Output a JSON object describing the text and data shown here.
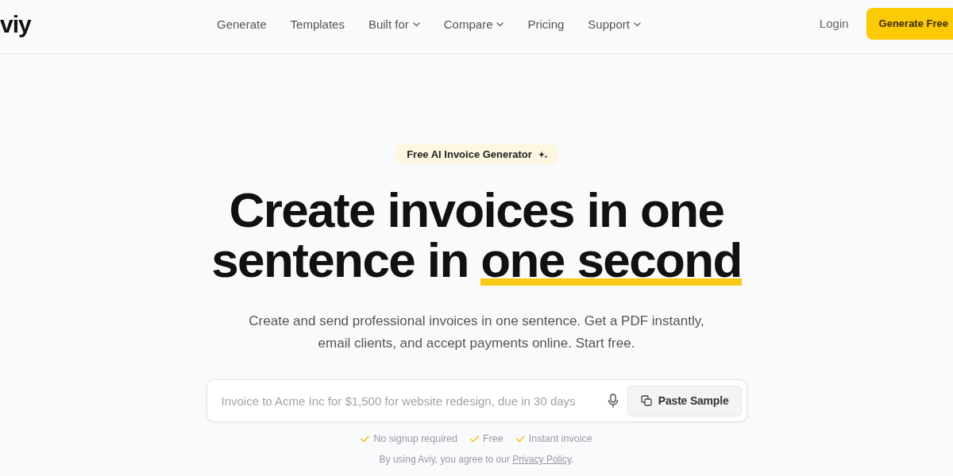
{
  "header": {
    "logo": "viy",
    "nav": [
      {
        "label": "Generate",
        "dropdown": false
      },
      {
        "label": "Templates",
        "dropdown": false
      },
      {
        "label": "Built for",
        "dropdown": true
      },
      {
        "label": "Compare",
        "dropdown": true
      },
      {
        "label": "Pricing",
        "dropdown": false
      },
      {
        "label": "Support",
        "dropdown": true
      }
    ],
    "login": "Login",
    "cta": "Generate Free"
  },
  "hero": {
    "badge": "Free AI Invoice Generator",
    "headline": {
      "text": "Create invoices in one sentence in",
      "highlight": "one second"
    },
    "subtitle": "Create and send professional invoices in one sentence. Get a PDF instantly, email clients, and accept payments online. Start free.",
    "prompt": {
      "placeholder": "Invoice to Acme Inc for $1,500 for website redesign, due in 30 days",
      "button": "Paste Sample"
    },
    "perks": [
      "No signup required",
      "Free",
      "Instant invoice"
    ],
    "consent": {
      "text": "By using Aviy, you agree to our",
      "link": "Privacy Policy",
      "end": "."
    }
  }
}
